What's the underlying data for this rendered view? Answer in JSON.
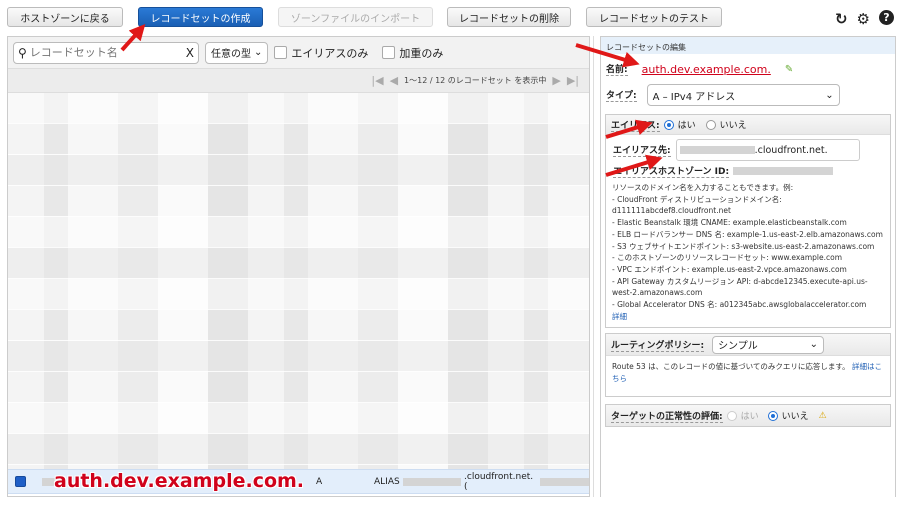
{
  "toolbar": {
    "back": "ホストゾーンに戻る",
    "create": "レコードセットの作成",
    "import": "ゾーンファイルのインポート",
    "delete": "レコードセットの削除",
    "test": "レコードセットのテスト"
  },
  "icons": {
    "refresh": "↻",
    "settings": "⚙",
    "help": "?"
  },
  "filter": {
    "search_placeholder": "レコードセット名",
    "clear": "X",
    "type_select": "任意の型",
    "alias_only": "エイリアスのみ",
    "weighted_only": "加重のみ"
  },
  "pager": {
    "first": "|◀",
    "prev": "◀",
    "text": "1～12 / 12 のレコードセット を表示中",
    "next": "▶",
    "last": "▶|"
  },
  "selected_row": {
    "type": "A",
    "value_prefix": "ALIAS",
    "value_suffix": ".cloudfront.net. (",
    "annotation": "auth.dev.example.com."
  },
  "editor": {
    "title": "レコードセットの編集",
    "name_label": "名前:",
    "name_value": "auth.dev.example.com.",
    "type_label": "タイプ:",
    "type_value": "A – IPv4 アドレス",
    "alias_label": "エイリアス:",
    "yes": "はい",
    "no": "いいえ",
    "alias_target_label": "エイリアス先:",
    "alias_target_value": ".cloudfront.net.",
    "alias_zone_label": "エイリアスホストゾーン ID:",
    "help_lines": [
      "リソースのドメイン名を入力することもできます。例:",
      "- CloudFront ディストリビューションドメイン名:",
      "d111111abcdef8.cloudfront.net",
      "- Elastic Beanstalk 環境 CNAME: example.elasticbeanstalk.com",
      "- ELB ロードバランサー DNS 名: example-1.us-east-2.elb.amazonaws.com",
      "- S3 ウェブサイトエンドポイント: s3-website.us-east-2.amazonaws.com",
      "- このホストゾーンのリソースレコードセット: www.example.com",
      "- VPC エンドポイント: example.us-east-2.vpce.amazonaws.com",
      "- API Gateway カスタムリージョン API: d-abcde12345.execute-api.us-",
      "west-2.amazonaws.com",
      "- Global Accelerator DNS 名: a012345abc.awsglobalaccelerator.com"
    ],
    "details_link": "詳細",
    "routing_label": "ルーティングポリシー:",
    "routing_value": "シンプル",
    "routing_help": "Route 53 は、このレコードの値に基づいてのみクエリに応答します。",
    "routing_link": "詳細はこちら",
    "health_label": "ターゲットの正常性の評価:",
    "health_warning": "⚠"
  },
  "colors": {
    "annotation": "#d0021b",
    "primary": "#1a5fb4"
  }
}
